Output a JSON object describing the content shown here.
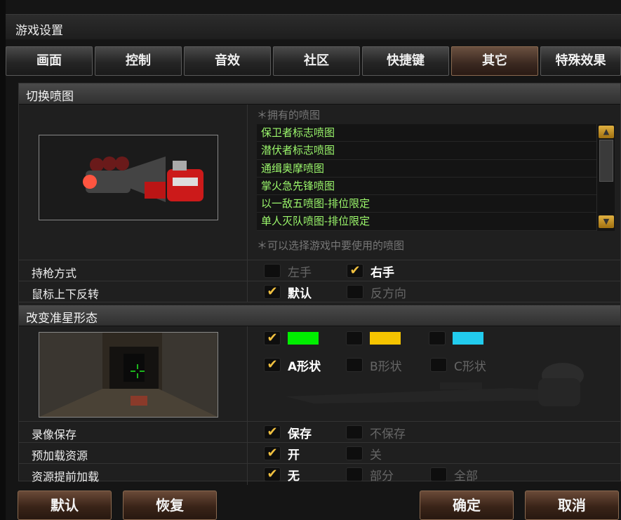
{
  "window_title": "游戏设置",
  "tabs": [
    "画面",
    "控制",
    "音效",
    "社区",
    "快捷键",
    "其它",
    "特殊效果"
  ],
  "spray": {
    "section_title": "切换喷图",
    "owned_hint": "＊拥有的喷图",
    "items": [
      "保卫者标志喷图",
      "潜伏者标志喷图",
      "通缉奥摩喷图",
      "掌火急先锋喷图",
      "以一敌五喷图-排位限定",
      "单人灭队喷图-排位限定"
    ],
    "select_hint": "＊可以选择游戏中要使用的喷图"
  },
  "grip": {
    "label": "持枪方式",
    "left": "左手",
    "right": "右手"
  },
  "mouse_invert": {
    "label": "鼠标上下反转",
    "default": "默认",
    "reverse": "反方向"
  },
  "crosshair": {
    "section_title": "改变准星形态",
    "colors": [
      "#00ee00",
      "#f5c400",
      "#22ccee"
    ],
    "shape_a": "A形状",
    "shape_b": "B形状",
    "shape_c": "C形状"
  },
  "record": {
    "label": "录像保存",
    "save": "保存",
    "nosave": "不保存"
  },
  "preload": {
    "label": "预加载资源",
    "on": "开",
    "off": "关"
  },
  "early_load": {
    "label": "资源提前加载",
    "none": "无",
    "partial": "部分",
    "all": "全部"
  },
  "buttons": {
    "default": "默认",
    "restore": "恢复",
    "confirm": "确定",
    "cancel": "取消"
  },
  "check_mark": "✔"
}
